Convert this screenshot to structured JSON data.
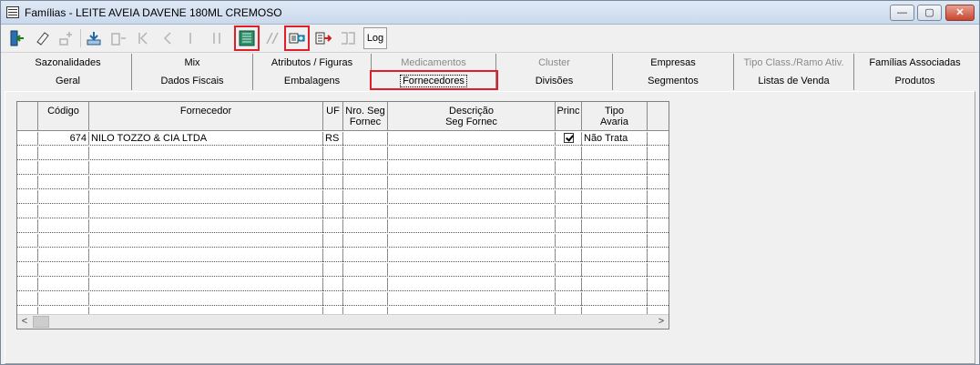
{
  "window": {
    "title": "Famílias - LEITE AVEIA DAVENE 180ML CREMOSO",
    "min_label": "—",
    "max_label": "▢",
    "close_label": "✕"
  },
  "toolbar": {
    "log_label": "Log",
    "highlight_color": "#e11d2a"
  },
  "tabs": {
    "row1": [
      {
        "label": "Sazonalidades"
      },
      {
        "label": "Mix"
      },
      {
        "label": "Atributos / Figuras"
      },
      {
        "label": "Medicamentos"
      },
      {
        "label": "Cluster"
      },
      {
        "label": "Empresas"
      },
      {
        "label": "Tipo Class./Ramo Ativ."
      },
      {
        "label": "Famílias Associadas"
      }
    ],
    "row2": [
      {
        "label": "Geral"
      },
      {
        "label": "Dados Fiscais"
      },
      {
        "label": "Embalagens"
      },
      {
        "label": "Fornecedores"
      },
      {
        "label": "Divisões"
      },
      {
        "label": "Segmentos"
      },
      {
        "label": "Listas de Venda"
      },
      {
        "label": "Produtos"
      }
    ]
  },
  "grid": {
    "headers": {
      "codigo": "Código",
      "fornecedor": "Fornecedor",
      "uf": "UF",
      "nro_seg_1": "Nro. Seg",
      "nro_seg_2": "Fornec",
      "descricao_1": "Descrição",
      "descricao_2": "Seg Fornec",
      "princ": "Princ",
      "tipo_1": "Tipo",
      "tipo_2": "Avaria"
    },
    "rows": [
      {
        "codigo": "674",
        "fornecedor": "NILO TOZZO & CIA LTDA",
        "uf": "RS",
        "nro_seg": "",
        "descricao": "",
        "princ": true,
        "tipo_avaria": "Não Trata"
      }
    ],
    "scroll_left": "<",
    "scroll_right": ">"
  }
}
